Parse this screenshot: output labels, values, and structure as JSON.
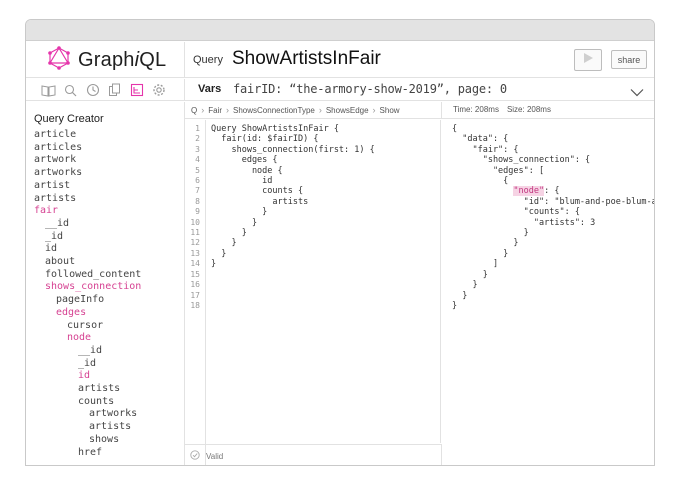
{
  "app": {
    "name_prefix": "Graph",
    "name_italic": "i",
    "name_suffix": "QL",
    "accent": "#e535ab"
  },
  "header": {
    "query_tag": "Query",
    "query_name": "ShowArtistsInFair",
    "share_label": "share"
  },
  "toolbar": {
    "icons": [
      "docs-icon",
      "search-icon",
      "history-icon",
      "copy-icon",
      "query-creator-icon",
      "settings-icon"
    ]
  },
  "variables": {
    "label": "Vars",
    "value": "fairID: “the-armory-show-2019”, page: 0"
  },
  "breadcrumb": [
    "Q",
    "Fair",
    "ShowsConnectionType",
    "ShowsEdge",
    "Show"
  ],
  "stats": {
    "time": "Time: 208ms",
    "size": "Size: 208ms"
  },
  "sidebar": {
    "title": "Query Creator",
    "items": [
      {
        "label": "article",
        "level": 0,
        "selected": false
      },
      {
        "label": "articles",
        "level": 0,
        "selected": false
      },
      {
        "label": "artwork",
        "level": 0,
        "selected": false
      },
      {
        "label": "artworks",
        "level": 0,
        "selected": false
      },
      {
        "label": "artist",
        "level": 0,
        "selected": false
      },
      {
        "label": "artists",
        "level": 0,
        "selected": false
      },
      {
        "label": "fair",
        "level": 0,
        "selected": true
      },
      {
        "label": "__id",
        "level": 1,
        "selected": false
      },
      {
        "label": "_id",
        "level": 1,
        "selected": false
      },
      {
        "label": "id",
        "level": 1,
        "selected": false
      },
      {
        "label": "about",
        "level": 1,
        "selected": false
      },
      {
        "label": "followed_content",
        "level": 1,
        "selected": false
      },
      {
        "label": "shows_connection",
        "level": 1,
        "selected": true
      },
      {
        "label": "pageInfo",
        "level": 2,
        "selected": false
      },
      {
        "label": "edges",
        "level": 2,
        "selected": true
      },
      {
        "label": "cursor",
        "level": 3,
        "selected": false
      },
      {
        "label": "node",
        "level": 3,
        "selected": true
      },
      {
        "label": "__id",
        "level": 4,
        "selected": false
      },
      {
        "label": "_id",
        "level": 4,
        "selected": false
      },
      {
        "label": "id",
        "level": 4,
        "selected": true
      },
      {
        "label": "artists",
        "level": 4,
        "selected": false
      },
      {
        "label": "counts",
        "level": 4,
        "selected": false
      },
      {
        "label": "artworks",
        "level": 5,
        "selected": false
      },
      {
        "label": "artists",
        "level": 5,
        "selected": false
      },
      {
        "label": "shows",
        "level": 5,
        "selected": false
      },
      {
        "label": "href",
        "level": 4,
        "selected": false
      }
    ]
  },
  "editor": {
    "line_numbers": [
      "1",
      "2",
      "3",
      "4",
      "5",
      "6",
      "7",
      "8",
      "9",
      "10",
      "11",
      "12",
      "13",
      "14",
      "15",
      "16",
      "17",
      "18"
    ],
    "lines": [
      "Query ShowArtistsInFair {",
      "  fair(id: $fairID) {",
      "    shows_connection(first: 1) {",
      "      edges {",
      "        node {",
      "          id",
      "          counts {",
      "            artists",
      "          }",
      "        }",
      "      }",
      "    }",
      "  }",
      "}"
    ],
    "status": "Valid"
  },
  "result": {
    "lines": [
      {
        "pre": "{",
        "hl": "",
        "post": ""
      },
      {
        "pre": "  \"data\": {",
        "hl": "",
        "post": ""
      },
      {
        "pre": "    \"fair\": {",
        "hl": "",
        "post": ""
      },
      {
        "pre": "      \"shows_connection\": {",
        "hl": "",
        "post": ""
      },
      {
        "pre": "        \"edges\": [",
        "hl": "",
        "post": ""
      },
      {
        "pre": "          {",
        "hl": "",
        "post": ""
      },
      {
        "pre": "            ",
        "hl": "\"node\"",
        "post": ": {"
      },
      {
        "pre": "              \"id\": \"blum-and-poe-blum-and-poe\",",
        "hl": "",
        "post": ""
      },
      {
        "pre": "              \"counts\": {",
        "hl": "",
        "post": ""
      },
      {
        "pre": "                \"artists\": 3",
        "hl": "",
        "post": ""
      },
      {
        "pre": "              }",
        "hl": "",
        "post": ""
      },
      {
        "pre": "            }",
        "hl": "",
        "post": ""
      },
      {
        "pre": "          }",
        "hl": "",
        "post": ""
      },
      {
        "pre": "        ]",
        "hl": "",
        "post": ""
      },
      {
        "pre": "      }",
        "hl": "",
        "post": ""
      },
      {
        "pre": "    }",
        "hl": "",
        "post": ""
      },
      {
        "pre": "  }",
        "hl": "",
        "post": ""
      },
      {
        "pre": "}",
        "hl": "",
        "post": ""
      }
    ]
  }
}
